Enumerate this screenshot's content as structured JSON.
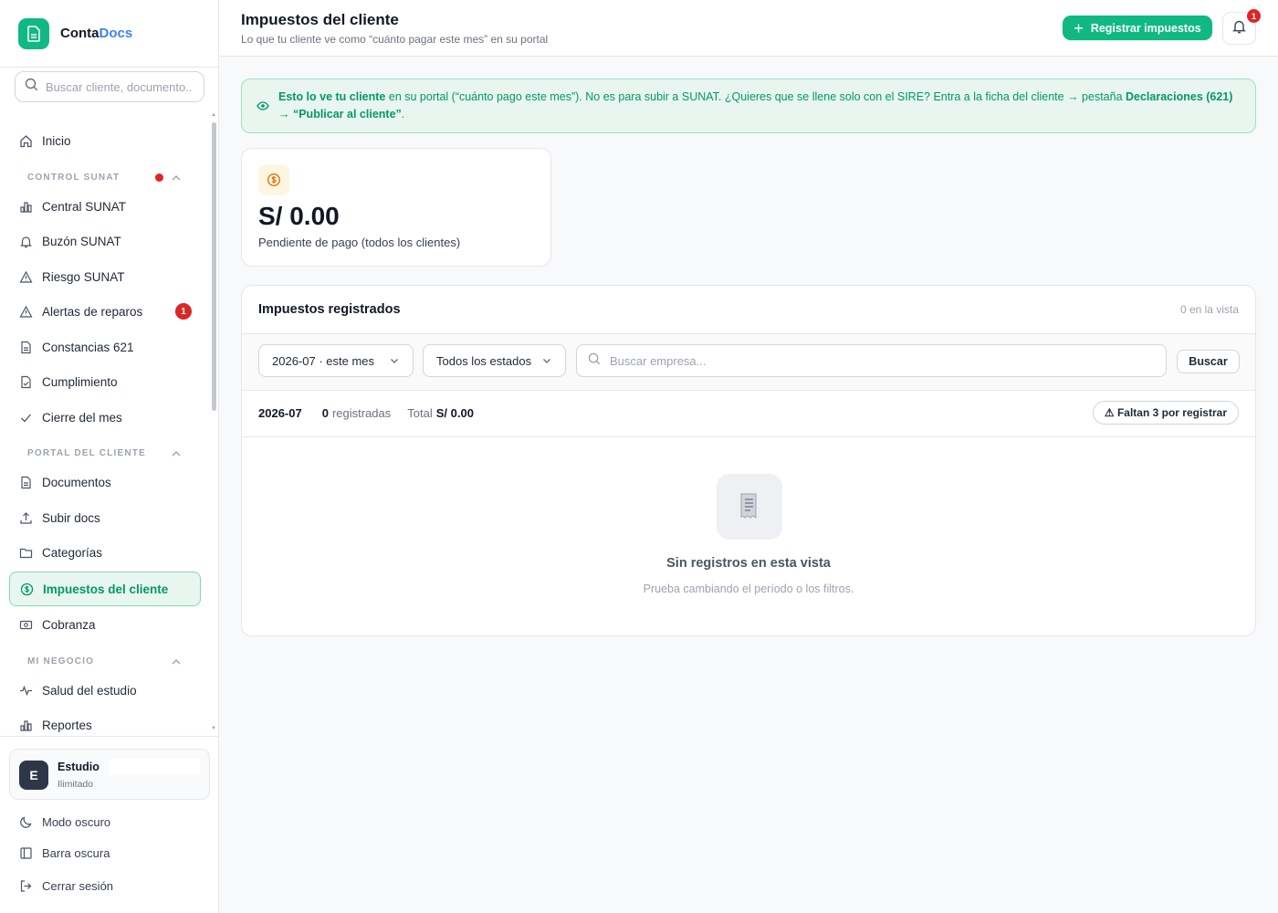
{
  "brand": {
    "name_part1": "Conta",
    "name_part2": "Docs"
  },
  "sidebar": {
    "search_placeholder": "Buscar cliente, documento...",
    "inicio": "Inicio",
    "section_control": "CONTROL SUNAT",
    "central_sunat": "Central SUNAT",
    "buzon_sunat": "Buzón SUNAT",
    "riesgo_sunat": "Riesgo SUNAT",
    "alertas_reparos": "Alertas de reparos",
    "alertas_badge": "1",
    "constancias": "Constancias 621",
    "cumplimiento": "Cumplimiento",
    "cierre_mes": "Cierre del mes",
    "section_portal": "PORTAL DEL CLIENTE",
    "documentos": "Documentos",
    "subir_docs": "Subir docs",
    "categorias": "Categorías",
    "impuestos_cliente": "Impuestos del cliente",
    "cobranza": "Cobranza",
    "section_negocio": "MI NEGOCIO",
    "salud_estudio": "Salud del estudio",
    "reportes": "Reportes",
    "studio_initial": "E",
    "studio_name": "Estudio",
    "studio_plan": "Ilimitado",
    "modo_oscuro": "Modo oscuro",
    "barra_oscura": "Barra oscura",
    "cerrar_sesion": "Cerrar sesión"
  },
  "header": {
    "title": "Impuestos del cliente",
    "subtitle": "Lo que tu cliente ve como “cuánto pagar este mes” en su portal",
    "register_button": "Registrar impuestos",
    "bell_badge": "1"
  },
  "banner": {
    "part1": "Esto lo ve tu cliente",
    "part2": " en su portal (“cuánto pago este mes”). No es para subir a SUNAT. ¿Quieres que se llene solo con el SIRE? Entra a la ficha del cliente → pestaña ",
    "part3": "Declaraciones (621) → “Publicar al cliente”",
    "part4": "."
  },
  "stat": {
    "value": "S/ 0.00",
    "label": "Pendiente de pago (todos los clientes)"
  },
  "panel": {
    "title": "Impuestos registrados",
    "count": "0 en la vista",
    "period_select": "2026-07 · este mes",
    "status_select": "Todos los estados",
    "search_placeholder": "Buscar empresa...",
    "search_button": "Buscar",
    "summary_period": "2026-07",
    "summary_count": "0",
    "summary_count_label": "registradas",
    "summary_total_label": "Total",
    "summary_total_value": "S/ 0.00",
    "missing_pill": "⚠ Faltan 3 por registrar",
    "empty_title": "Sin registros en esta vista",
    "empty_sub": "Prueba cambiando el período o los filtros."
  },
  "colors": {
    "accent_green": "#10b981",
    "active_text": "#059669",
    "badge_red": "#dc2626",
    "brand_blue": "#3b82f6"
  }
}
